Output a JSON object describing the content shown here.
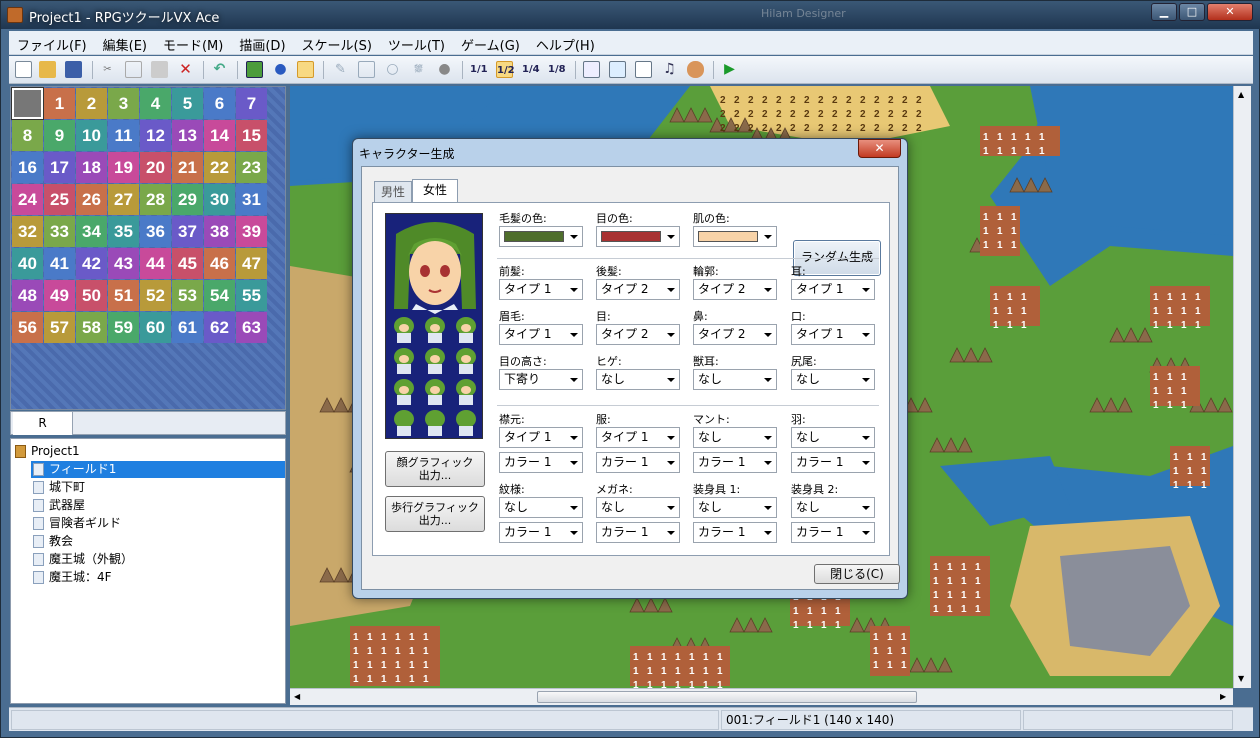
{
  "window": {
    "title": "Project1 - RPGツクールVX Ace",
    "faint_center": "Hilam Designer",
    "controls": {
      "minimize": "▁",
      "maximize": "□",
      "close": "✕"
    }
  },
  "menu": [
    "ファイル(F)",
    "編集(E)",
    "モード(M)",
    "描画(D)",
    "スケール(S)",
    "ツール(T)",
    "ゲーム(G)",
    "ヘルプ(H)"
  ],
  "toolbar": {
    "icons": [
      "new-icon",
      "open-icon",
      "save-icon",
      "cut-icon",
      "copy-icon",
      "paste-icon",
      "delete-icon",
      "undo-icon",
      "map-mode-icon",
      "event-mode-icon",
      "region-mode-icon",
      "pencil-icon",
      "rectangle-icon",
      "ellipse-icon",
      "fill-icon",
      "shadow-pen-icon",
      "scale-1-1-icon",
      "scale-1-2-icon",
      "scale-1-4-icon",
      "scale-1-8-icon",
      "database-icon",
      "resource-manager-icon",
      "script-editor-icon",
      "sound-test-icon",
      "character-generator-icon",
      "playtest-icon"
    ],
    "scale_labels": {
      "s1": "1/1",
      "s2": "1/2",
      "s4": "1/4",
      "s8": "1/8"
    }
  },
  "palette": {
    "tiles": [
      "",
      "1",
      "2",
      "3",
      "4",
      "5",
      "6",
      "7",
      "8",
      "9",
      "10",
      "11",
      "12",
      "13",
      "14",
      "15",
      "16",
      "17",
      "18",
      "19",
      "20",
      "21",
      "22",
      "23",
      "24",
      "25",
      "26",
      "27",
      "28",
      "29",
      "30",
      "31",
      "32",
      "33",
      "34",
      "35",
      "36",
      "37",
      "38",
      "39",
      "40",
      "41",
      "42",
      "43",
      "44",
      "45",
      "46",
      "47",
      "48",
      "49",
      "50",
      "51",
      "52",
      "53",
      "54",
      "55",
      "56",
      "57",
      "58",
      "59",
      "60",
      "61",
      "62",
      "63"
    ],
    "tab": "R"
  },
  "map_tree": [
    {
      "label": "Project1",
      "root": true
    },
    {
      "label": "フィールド1",
      "selected": true
    },
    {
      "label": "城下町"
    },
    {
      "label": "武器屋"
    },
    {
      "label": "冒険者ギルド"
    },
    {
      "label": "教会"
    },
    {
      "label": "魔王城（外観）"
    },
    {
      "label": "魔王城：4F"
    }
  ],
  "status": {
    "map_info": "001:フィールド1 (140 x 140)"
  },
  "dialog": {
    "title": "キャラクター生成",
    "close_glyph": "✕",
    "tabs": {
      "male": "男性",
      "female": "女性"
    },
    "buttons": {
      "random": "ランダム生成",
      "face_output": "顔グラフィック\n出力...",
      "walk_output": "歩行グラフィック\n出力...",
      "close": "閉じる(C)"
    },
    "colors": {
      "hair": {
        "label": "毛髪の色:",
        "value": "#4f6e2c"
      },
      "eye": {
        "label": "目の色:",
        "value": "#a83232"
      },
      "skin": {
        "label": "肌の色:",
        "value": "#f8d3a8"
      }
    },
    "parts": {
      "front_hair": {
        "label": "前髪:",
        "value": "タイプ 1"
      },
      "rear_hair": {
        "label": "後髪:",
        "value": "タイプ 2"
      },
      "outline": {
        "label": "輪郭:",
        "value": "タイプ 2"
      },
      "ears": {
        "label": "耳:",
        "value": "タイプ 1"
      },
      "eyebrows": {
        "label": "眉毛:",
        "value": "タイプ 1"
      },
      "eyes": {
        "label": "目:",
        "value": "タイプ 2"
      },
      "nose": {
        "label": "鼻:",
        "value": "タイプ 2"
      },
      "mouth": {
        "label": "口:",
        "value": "タイプ 1"
      },
      "eye_height": {
        "label": "目の高さ:",
        "value": "下寄り"
      },
      "beard": {
        "label": "ヒゲ:",
        "value": "なし"
      },
      "beast_ears": {
        "label": "獣耳:",
        "value": "なし"
      },
      "tail": {
        "label": "尻尾:",
        "value": "なし"
      },
      "collar": {
        "label": "襟元:",
        "type": "タイプ 1",
        "color": "カラー 1"
      },
      "clothes": {
        "label": "服:",
        "type": "タイプ 1",
        "color": "カラー 1"
      },
      "cloak": {
        "label": "マント:",
        "type": "なし",
        "color": "カラー 1"
      },
      "wings": {
        "label": "羽:",
        "type": "なし",
        "color": "カラー 1"
      },
      "pattern": {
        "label": "紋様:",
        "type": "なし",
        "color": "カラー 1"
      },
      "glasses": {
        "label": "メガネ:",
        "type": "なし",
        "color": "カラー 1"
      },
      "accessory1": {
        "label": "装身具 1:",
        "type": "なし",
        "color": "カラー 1"
      },
      "accessory2": {
        "label": "装身具 2:",
        "type": "なし",
        "color": "カラー 1"
      }
    }
  },
  "map_tile_labels": {
    "one": "1",
    "two": "2"
  },
  "accent_colors": {
    "selection": "#1f7fe0",
    "title_bar": "#2a4766",
    "water": "#2f78b8",
    "grass": "#5a9e3a",
    "mountain": "#8a6a4a"
  }
}
